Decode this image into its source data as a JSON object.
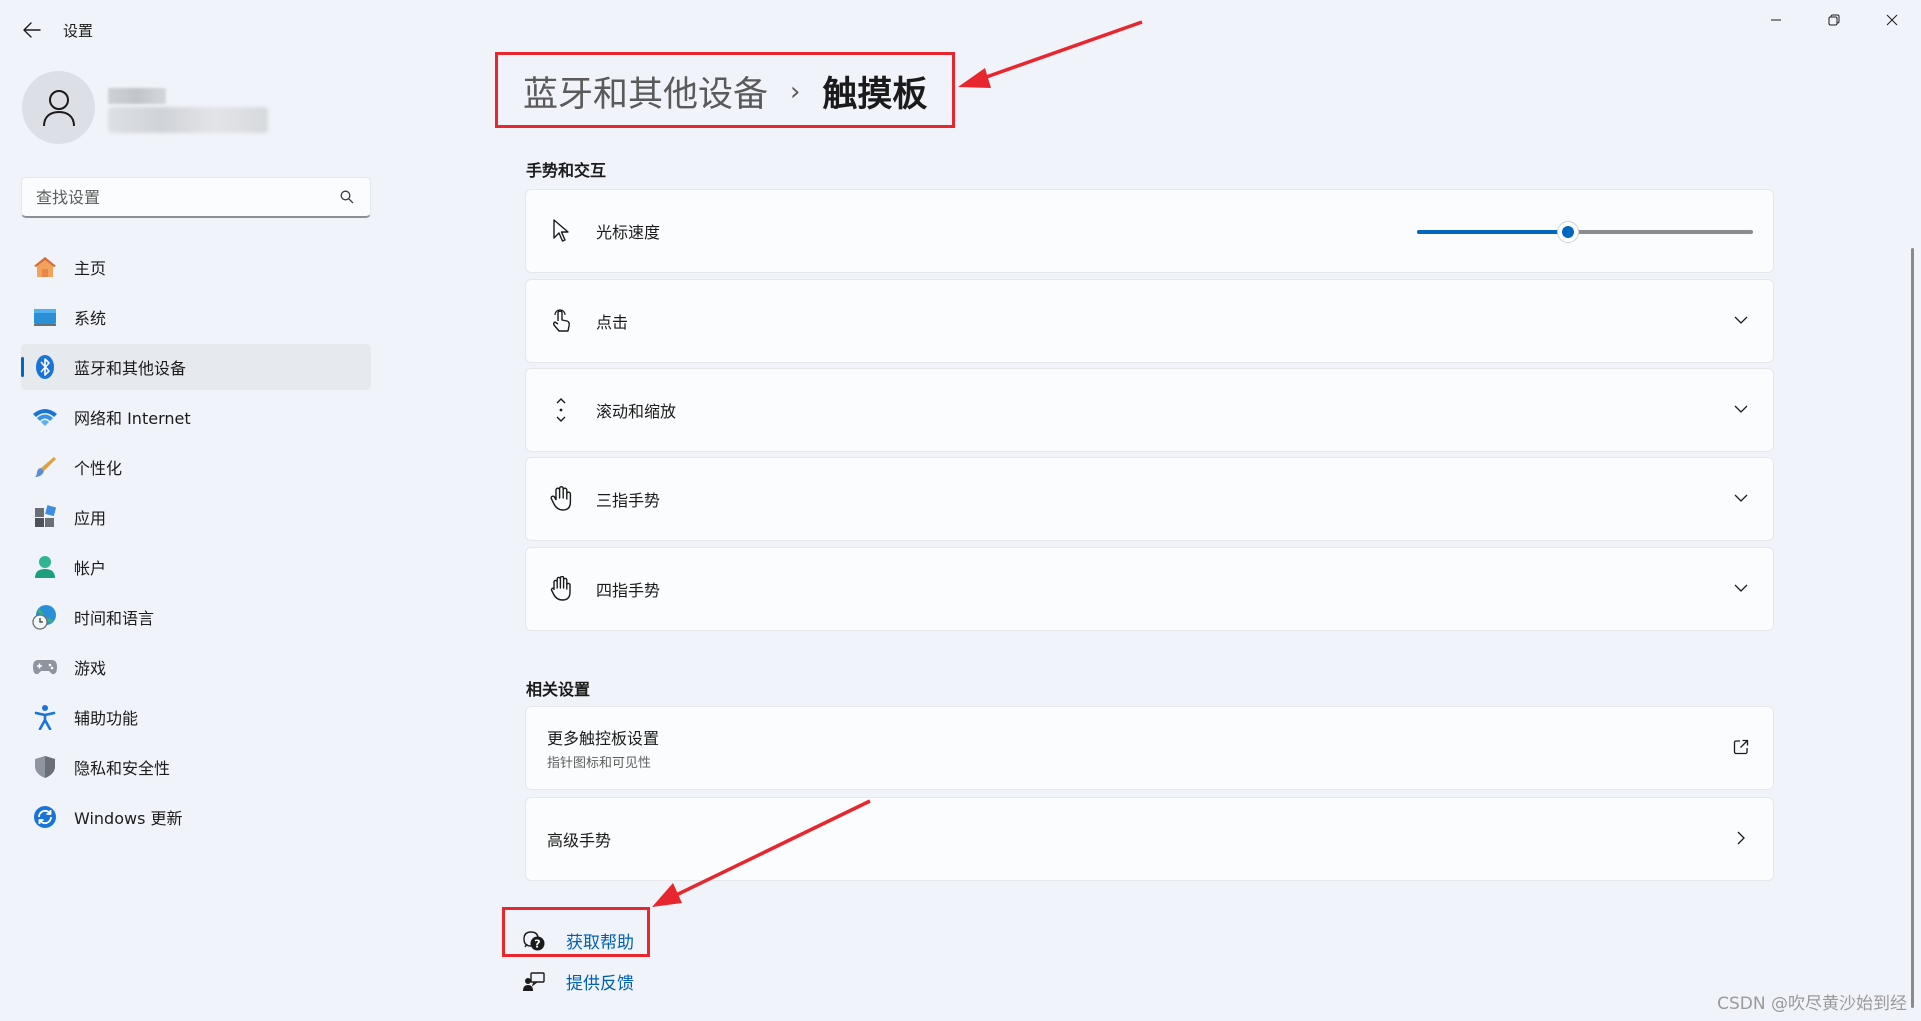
{
  "window": {
    "title": "设置",
    "back_label": "back",
    "controls": [
      "minimize-icon",
      "restore-icon",
      "close-icon"
    ]
  },
  "search": {
    "placeholder": "查找设置"
  },
  "sidebar": {
    "items": [
      {
        "label": "主页",
        "icon": "home-icon"
      },
      {
        "label": "系统",
        "icon": "system-icon"
      },
      {
        "label": "蓝牙和其他设备",
        "icon": "bluetooth-icon",
        "active": true
      },
      {
        "label": "网络和 Internet",
        "icon": "wifi-icon"
      },
      {
        "label": "个性化",
        "icon": "brush-icon"
      },
      {
        "label": "应用",
        "icon": "apps-icon"
      },
      {
        "label": "帐户",
        "icon": "account-icon"
      },
      {
        "label": "时间和语言",
        "icon": "globe-clock-icon"
      },
      {
        "label": "游戏",
        "icon": "gamepad-icon"
      },
      {
        "label": "辅助功能",
        "icon": "accessibility-icon"
      },
      {
        "label": "隐私和安全性",
        "icon": "shield-icon"
      },
      {
        "label": "Windows 更新",
        "icon": "update-icon"
      }
    ]
  },
  "breadcrumb": {
    "parent": "蓝牙和其他设备",
    "separator": "›",
    "current": "触摸板"
  },
  "gestures": {
    "section_title": "手势和交互",
    "cursor_speed": {
      "label": "光标速度",
      "value_fraction": 0.45
    },
    "items": [
      {
        "label": "点击",
        "icon": "tap-icon"
      },
      {
        "label": "滚动和缩放",
        "icon": "scroll-icon"
      },
      {
        "label": "三指手势",
        "icon": "hand-three-icon"
      },
      {
        "label": "四指手势",
        "icon": "hand-four-icon"
      }
    ]
  },
  "related": {
    "section_title": "相关设置",
    "more_touchpad": {
      "title": "更多触控板设置",
      "subtitle": "指针图标和可见性"
    },
    "advanced": {
      "title": "高级手势"
    }
  },
  "links": {
    "help": "获取帮助",
    "feedback": "提供反馈"
  },
  "watermark": "CSDN @吹尽黄沙始到经",
  "colors": {
    "accent": "#0067c0",
    "annotation": "#e8262d",
    "link": "#005fb8"
  }
}
